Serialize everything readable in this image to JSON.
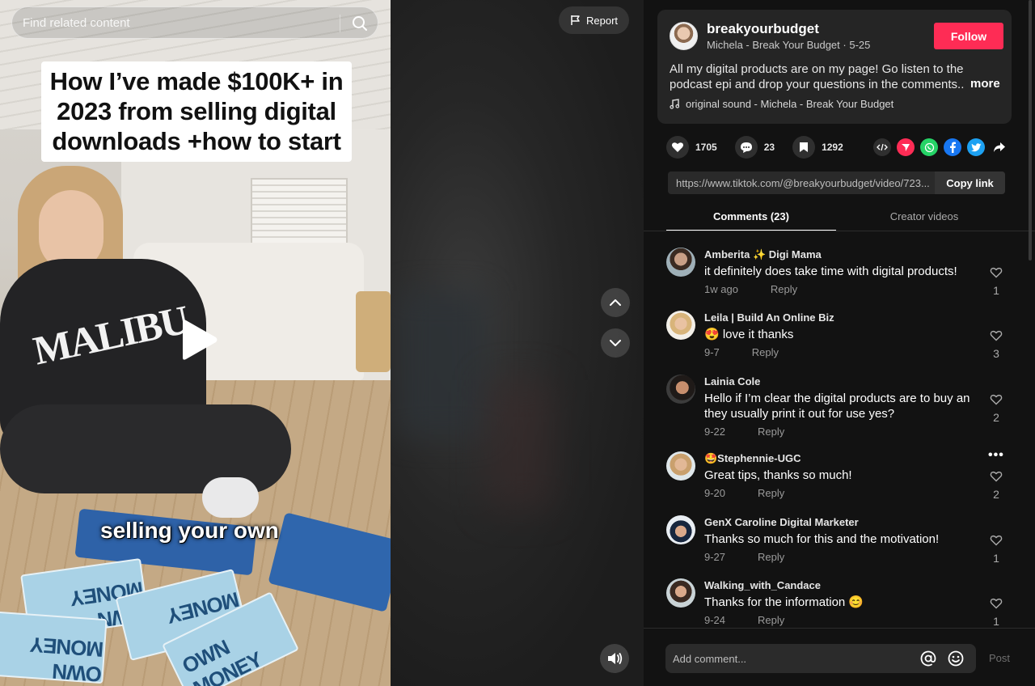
{
  "video": {
    "search_placeholder": "Find related content",
    "report_label": "Report",
    "overlay_title_line1": "How I’ve made $100K+ in",
    "overlay_title_line2": "2023 from selling digital",
    "overlay_title_line3": "downloads +how to start",
    "caption": "selling your own",
    "sweatshirt_text": "MALIBU",
    "book_text": "OWN MONEY"
  },
  "author": {
    "username": "breakyourbudget",
    "display_name": "Michela - Break Your Budget",
    "date": "5-25",
    "follow_label": "Follow",
    "description_line1": "All my digital products are on my page! Go listen to the",
    "description_line2": "podcast epi and drop your questions in the comments...",
    "more_label": "more",
    "sound": "original sound - Michela - Break Your Budget"
  },
  "stats": {
    "likes": "1705",
    "comments": "23",
    "saves": "1292"
  },
  "share": {
    "link": "https://www.tiktok.com/@breakyourbudget/video/723...",
    "copy_label": "Copy link"
  },
  "tabs": {
    "comments": "Comments (23)",
    "creator_videos": "Creator videos"
  },
  "comments": [
    {
      "name": "Amberita ✨ Digi Mama",
      "text": "it definitely does take time with digital products!",
      "date": "1w ago",
      "reply": "Reply",
      "likes": "1"
    },
    {
      "name": "Leila | Build An Online Biz",
      "text": "😍 love it thanks",
      "date": "9-7",
      "reply": "Reply",
      "likes": "3"
    },
    {
      "name": "Lainia Cole",
      "text": "Hello if I’m clear the digital products are to buy an they usually print it out for use yes?",
      "date": "9-22",
      "reply": "Reply",
      "likes": "2"
    },
    {
      "name": "🤩Stephennie-UGC",
      "text": "Great tips, thanks so much!",
      "date": "9-20",
      "reply": "Reply",
      "likes": "2"
    },
    {
      "name": "GenX Caroline Digital Marketer",
      "text": "Thanks so much for this and the motivation!",
      "date": "9-27",
      "reply": "Reply",
      "likes": "1"
    },
    {
      "name": "Walking_with_Candace",
      "text": "Thanks for the information 😊",
      "date": "9-24",
      "reply": "Reply",
      "likes": "1"
    }
  ],
  "comment_bar": {
    "placeholder": "Add comment...",
    "post_label": "Post"
  },
  "colors": {
    "accent": "#fe2c55",
    "panel_bg": "#121212",
    "card_bg": "#252525"
  },
  "icons": [
    "search-icon",
    "flag-icon",
    "play-icon",
    "chevron-up-icon",
    "chevron-down-icon",
    "volume-icon",
    "heart-icon",
    "comment-icon",
    "bookmark-icon",
    "embed-icon",
    "send-icon",
    "whatsapp-icon",
    "facebook-icon",
    "twitter-icon",
    "share-arrow-icon",
    "music-note-icon",
    "at-icon",
    "emoji-icon",
    "more-dots-icon"
  ]
}
